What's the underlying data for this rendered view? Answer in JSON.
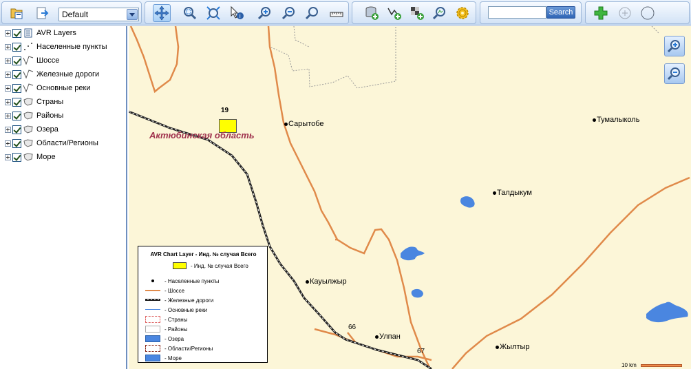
{
  "toolbar": {
    "scheme_select_value": "Default",
    "search_placeholder": "",
    "search_button_label": "Search",
    "buttons": [
      {
        "name": "open-project-icon"
      },
      {
        "name": "export-icon"
      },
      {
        "name": "pan-icon"
      },
      {
        "name": "zoom-window-icon"
      },
      {
        "name": "full-extent-icon"
      },
      {
        "name": "identify-icon"
      },
      {
        "name": "zoom-in-icon"
      },
      {
        "name": "zoom-out-icon"
      },
      {
        "name": "zoom-previous-icon"
      },
      {
        "name": "measure-icon"
      },
      {
        "name": "add-layer-icon"
      },
      {
        "name": "add-vector-icon"
      },
      {
        "name": "add-raster-icon"
      },
      {
        "name": "search-layer-icon"
      },
      {
        "name": "settings-icon"
      },
      {
        "name": "add-green-icon"
      },
      {
        "name": "add-circle-icon"
      },
      {
        "name": "circle-icon"
      }
    ]
  },
  "layers": [
    {
      "label": "AVR Layers",
      "icon": "document-icon"
    },
    {
      "label": "Населенные пункты",
      "icon": "points-icon"
    },
    {
      "label": "Шоссе",
      "icon": "line-icon"
    },
    {
      "label": "Железные дороги",
      "icon": "line-icon"
    },
    {
      "label": "Основные реки",
      "icon": "line-icon"
    },
    {
      "label": "Страны",
      "icon": "polygon-icon"
    },
    {
      "label": "Районы",
      "icon": "polygon-icon"
    },
    {
      "label": "Озера",
      "icon": "polygon-icon"
    },
    {
      "label": "Области/Регионы",
      "icon": "polygon-icon"
    },
    {
      "label": "Море",
      "icon": "polygon-icon"
    }
  ],
  "map": {
    "background_color": "#fcf6d8",
    "region_label": "Актюбинская область",
    "chart_value": "19",
    "cities": [
      {
        "name": "Сарытобе"
      },
      {
        "name": "Тумалыколь"
      },
      {
        "name": "Талдыкум"
      },
      {
        "name": "Кауылжыр"
      },
      {
        "name": "Улпан"
      },
      {
        "name": "Жылтыр"
      }
    ],
    "road_numbers": [
      "66",
      "67"
    ],
    "scale_label": "10 km"
  },
  "legend": {
    "title": "AVR Chart Layer - Инд. № случая Всего",
    "chart_item": "- Инд. № случая Всего",
    "items": [
      {
        "label": "- Населенные пункты",
        "symbol": "point"
      },
      {
        "label": "- Шоссе",
        "symbol": "road"
      },
      {
        "label": "- Железные дороги",
        "symbol": "rail"
      },
      {
        "label": "- Основные реки",
        "symbol": "river"
      },
      {
        "label": "- Страны",
        "symbol": "country"
      },
      {
        "label": "- Районы",
        "symbol": "district"
      },
      {
        "label": "- Озера",
        "symbol": "lake"
      },
      {
        "label": "- Области/Регионы",
        "symbol": "region"
      },
      {
        "label": "- Море",
        "symbol": "sea"
      }
    ]
  },
  "colors": {
    "road": "#e08a4a",
    "rail": "#222222",
    "lake": "#4a86e0",
    "region_label": "#a0334e",
    "chart_bar": "#ffff00",
    "boundary": "#888888"
  }
}
